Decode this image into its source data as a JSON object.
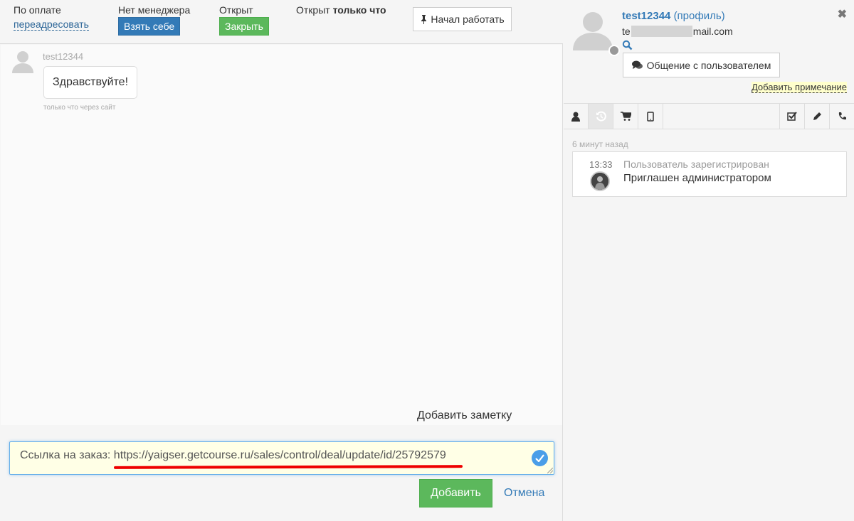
{
  "topbar": {
    "payment_label": "По оплате",
    "redirect_link": "переадресовать",
    "manager_label": "Нет менеджера",
    "take_button": "Взять себе",
    "status_label": "Открыт",
    "close_button": "Закрыть",
    "opened_prefix": "Открыт",
    "opened_time": "только что",
    "start_work_button": "Начал работать"
  },
  "chat": {
    "author": "test12344",
    "message": "Здравствуйте!",
    "meta": "только что через сайт",
    "add_note": "Добавить заметку"
  },
  "composer": {
    "text": "Ссылка на заказ: https://yaigser.getcourse.ru/sales/control/deal/update/id/25792579",
    "add_button": "Добавить",
    "cancel_link": "Отмена"
  },
  "profile": {
    "username": "test12344",
    "profile_link": "(профиль)",
    "email_prefix": "te",
    "email_suffix": "mail.com",
    "chat_button": "Общение с пользователем",
    "add_annotation": "Добавить примечание"
  },
  "tabs": [
    "user-icon",
    "history-icon",
    "cart-icon",
    "mobile-icon",
    "task-icon",
    "pencil-icon",
    "phone-icon"
  ],
  "history": {
    "time_ago": "6 минут назад",
    "event_time": "13:33",
    "event_title": "Пользователь зарегистрирован",
    "event_desc": "Приглашен администратором"
  },
  "colors": {
    "accent": "#337ab7",
    "success": "#5cb85c",
    "underline": "#e00000"
  }
}
